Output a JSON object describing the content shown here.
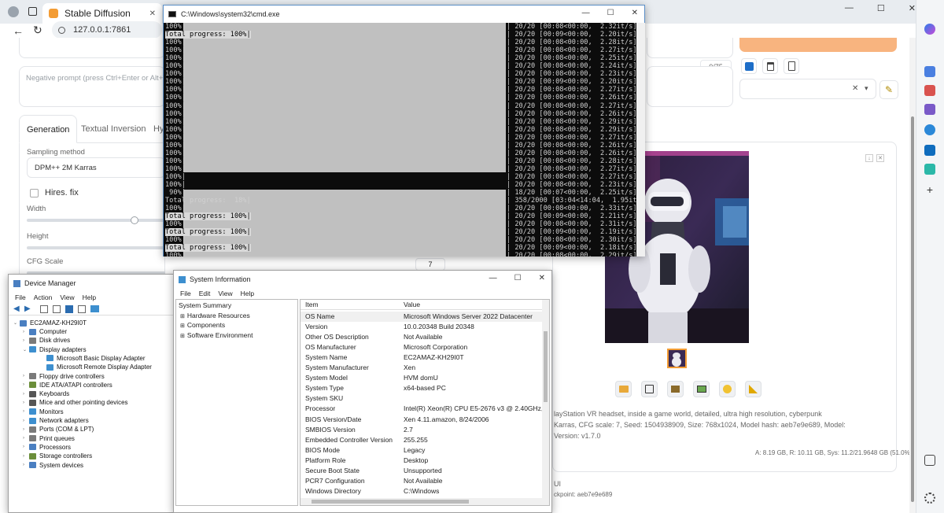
{
  "browser": {
    "tab_title": "Stable Diffusion",
    "tab_close": "✕",
    "url": "127.0.0.1:7861",
    "nav_back": "←",
    "nav_refresh": "↻",
    "window_min": "—",
    "window_max": "☐",
    "window_close": "✕"
  },
  "webui": {
    "negative_prompt_placeholder": "Negative prompt (press Ctrl+Enter or Alt+Enter t",
    "tabs": [
      "Generation",
      "Textual Inversion",
      "Hy"
    ],
    "sampling_method_label": "Sampling method",
    "sampling_method_value": "DPM++ 2M Karras",
    "hires_fix_label": "Hires. fix",
    "width_label": "Width",
    "height_label": "Height",
    "cfg_scale_label": "CFG Scale",
    "cfg_scale_value": "7",
    "token_counter": "0/75",
    "style_clear": "✕",
    "style_caret": "▾",
    "generation_info_1": "layStation VR headset, inside a game world, detailed, ultra high resolution, cyberpunk",
    "generation_info_2": "Karras, CFG scale: 7, Seed: 1504938909, Size: 768x1024, Model hash: aeb7e9e689, Model:",
    "generation_info_3": "Version: v1.7.0",
    "memory_stats": "A: 8.19 GB, R: 10.11 GB, Sys: 11.2/21.9648 GB (51.0%)",
    "footer_ui": "UI",
    "footer_checkpoint": "ckpoint: aeb7e9e689"
  },
  "cmd": {
    "title": "C:\\Windows\\system32\\cmd.exe",
    "lines": [
      {
        "l": "100%|",
        "r": "| 20/20 [00:08<00:00,  2.32it/s]"
      },
      {
        "l": "Total progress: 100%|",
        "r": "| 20/20 [00:09<00:00,  2.20it/s]",
        "prog": true
      },
      {
        "l": "100%|",
        "r": "| 20/20 [00:08<00:00,  2.28it/s]"
      },
      {
        "l": "100%|",
        "r": "| 20/20 [00:08<00:00,  2.27it/s]"
      },
      {
        "l": "100%|",
        "r": "| 20/20 [00:08<00:00,  2.25it/s]"
      },
      {
        "l": "100%|",
        "r": "| 20/20 [00:08<00:00,  2.24it/s]"
      },
      {
        "l": "100%|",
        "r": "| 20/20 [00:08<00:00,  2.23it/s]"
      },
      {
        "l": "100%|",
        "r": "| 20/20 [00:09<00:00,  2.20it/s]"
      },
      {
        "l": "100%|",
        "r": "| 20/20 [00:08<00:00,  2.27it/s]"
      },
      {
        "l": "100%|",
        "r": "| 20/20 [00:08<00:00,  2.26it/s]"
      },
      {
        "l": "100%|",
        "r": "| 20/20 [00:08<00:00,  2.27it/s]"
      },
      {
        "l": "100%|",
        "r": "| 20/20 [00:08<00:00,  2.26it/s]"
      },
      {
        "l": "100%|",
        "r": "| 20/20 [00:08<00:00,  2.29it/s]"
      },
      {
        "l": "100%|",
        "r": "| 20/20 [00:08<00:00,  2.29it/s]"
      },
      {
        "l": "100%|",
        "r": "| 20/20 [00:08<00:00,  2.27it/s]"
      },
      {
        "l": "100%|",
        "r": "| 20/20 [00:08<00:00,  2.26it/s]"
      },
      {
        "l": "100%|",
        "r": "| 20/20 [00:08<00:00,  2.26it/s]"
      },
      {
        "l": "100%|",
        "r": "| 20/20 [00:08<00:00,  2.28it/s]"
      },
      {
        "l": "100%|",
        "r": "| 20/20 [00:08<00:00,  2.27it/s]"
      },
      {
        "l": "100%|",
        "r": "| 20/20 [00:08<00:00,  2.27it/s]"
      },
      {
        "l": "100%|",
        "r": "| 20/20 [00:08<00:00,  2.23it/s]"
      },
      {
        "l": " 90%|",
        "r": "| 18/20 [00:07<00:00,  2.25it/s]"
      },
      {
        "l": "Total progress:  18%|",
        "r": "| 358/2000 [03:04<14:04,  1.95it/s]"
      },
      {
        "l": "100%|",
        "r": "| 20/20 [00:08<00:00,  2.33it/s]"
      },
      {
        "l": "Total progress: 100%|",
        "r": "| 20/20 [00:09<00:00,  2.21it/s]",
        "prog": true
      },
      {
        "l": "100%|",
        "r": "| 20/20 [00:08<00:00,  2.31it/s]"
      },
      {
        "l": "Total progress: 100%|",
        "r": "| 20/20 [00:09<00:00,  2.19it/s]",
        "prog": true
      },
      {
        "l": "100%|",
        "r": "| 20/20 [00:08<00:00,  2.30it/s]"
      },
      {
        "l": "Total progress: 100%|",
        "r": "| 20/20 [00:09<00:00,  2.18it/s]",
        "prog": true
      },
      {
        "l": "100%|",
        "r": "| 20/20 [00:08<00:00,  2.29it/s]"
      },
      {
        "l": "Total progress: 100%|",
        "r": "| 20/20 [00:08<00:00,  2.16it/s]",
        "prog": true
      },
      {
        "l": "Total progress: 100%|",
        "r": "| 20/20 [00:09<00:00,  2.29it/s]",
        "prog": true
      }
    ]
  },
  "device_manager": {
    "title": "Device Manager",
    "menu": [
      "File",
      "Action",
      "View",
      "Help"
    ],
    "root": "EC2AMAZ-KH29I0T",
    "nodes": [
      {
        "label": "Computer",
        "color": "#4a7fc1",
        "twist": "›"
      },
      {
        "label": "Disk drives",
        "color": "#7a7a7a",
        "twist": "›"
      },
      {
        "label": "Display adapters",
        "color": "#3d8fcf",
        "twist": "⌄"
      },
      {
        "label": "Microsoft Basic Display Adapter",
        "color": "#3d8fcf",
        "twist": ""
      },
      {
        "label": "Microsoft Remote Display Adapter",
        "color": "#3d8fcf",
        "twist": ""
      },
      {
        "label": "Floppy drive controllers",
        "color": "#7a7a7a",
        "twist": "›"
      },
      {
        "label": "IDE ATA/ATAPI controllers",
        "color": "#6b8e3a",
        "twist": "›"
      },
      {
        "label": "Keyboards",
        "color": "#555555",
        "twist": "›"
      },
      {
        "label": "Mice and other pointing devices",
        "color": "#555555",
        "twist": "›"
      },
      {
        "label": "Monitors",
        "color": "#3d8fcf",
        "twist": "›"
      },
      {
        "label": "Network adapters",
        "color": "#3d8fcf",
        "twist": "›"
      },
      {
        "label": "Ports (COM & LPT)",
        "color": "#7a7a7a",
        "twist": "›"
      },
      {
        "label": "Print queues",
        "color": "#7a7a7a",
        "twist": "›"
      },
      {
        "label": "Processors",
        "color": "#4a7fc1",
        "twist": "›"
      },
      {
        "label": "Storage controllers",
        "color": "#6b8e3a",
        "twist": "›"
      },
      {
        "label": "System devices",
        "color": "#4a7fc1",
        "twist": "›"
      }
    ]
  },
  "system_info": {
    "title": "System Information",
    "menu": [
      "File",
      "Edit",
      "View",
      "Help"
    ],
    "tree": [
      "System Summary",
      "Hardware Resources",
      "Components",
      "Software Environment"
    ],
    "col_item": "Item",
    "col_value": "Value",
    "rows": [
      {
        "k": "OS Name",
        "v": "Microsoft Windows Server 2022 Datacenter"
      },
      {
        "k": "Version",
        "v": "10.0.20348 Build 20348"
      },
      {
        "k": "Other OS Description",
        "v": "Not Available"
      },
      {
        "k": "OS Manufacturer",
        "v": "Microsoft Corporation"
      },
      {
        "k": "System Name",
        "v": "EC2AMAZ-KH29I0T"
      },
      {
        "k": "System Manufacturer",
        "v": "Xen"
      },
      {
        "k": "System Model",
        "v": "HVM domU"
      },
      {
        "k": "System Type",
        "v": "x64-based PC"
      },
      {
        "k": "System SKU",
        "v": ""
      },
      {
        "k": "Processor",
        "v": "Intel(R) Xeon(R) CPU E5-2676 v3 @ 2.40GHz, 240"
      },
      {
        "k": "BIOS Version/Date",
        "v": "Xen 4.11.amazon, 8/24/2006"
      },
      {
        "k": "SMBIOS Version",
        "v": "2.7"
      },
      {
        "k": "Embedded Controller Version",
        "v": "255.255"
      },
      {
        "k": "BIOS Mode",
        "v": "Legacy"
      },
      {
        "k": "Platform Role",
        "v": "Desktop"
      },
      {
        "k": "Secure Boot State",
        "v": "Unsupported"
      },
      {
        "k": "PCR7 Configuration",
        "v": "Not Available"
      },
      {
        "k": "Windows Directory",
        "v": "C:\\Windows"
      }
    ]
  }
}
